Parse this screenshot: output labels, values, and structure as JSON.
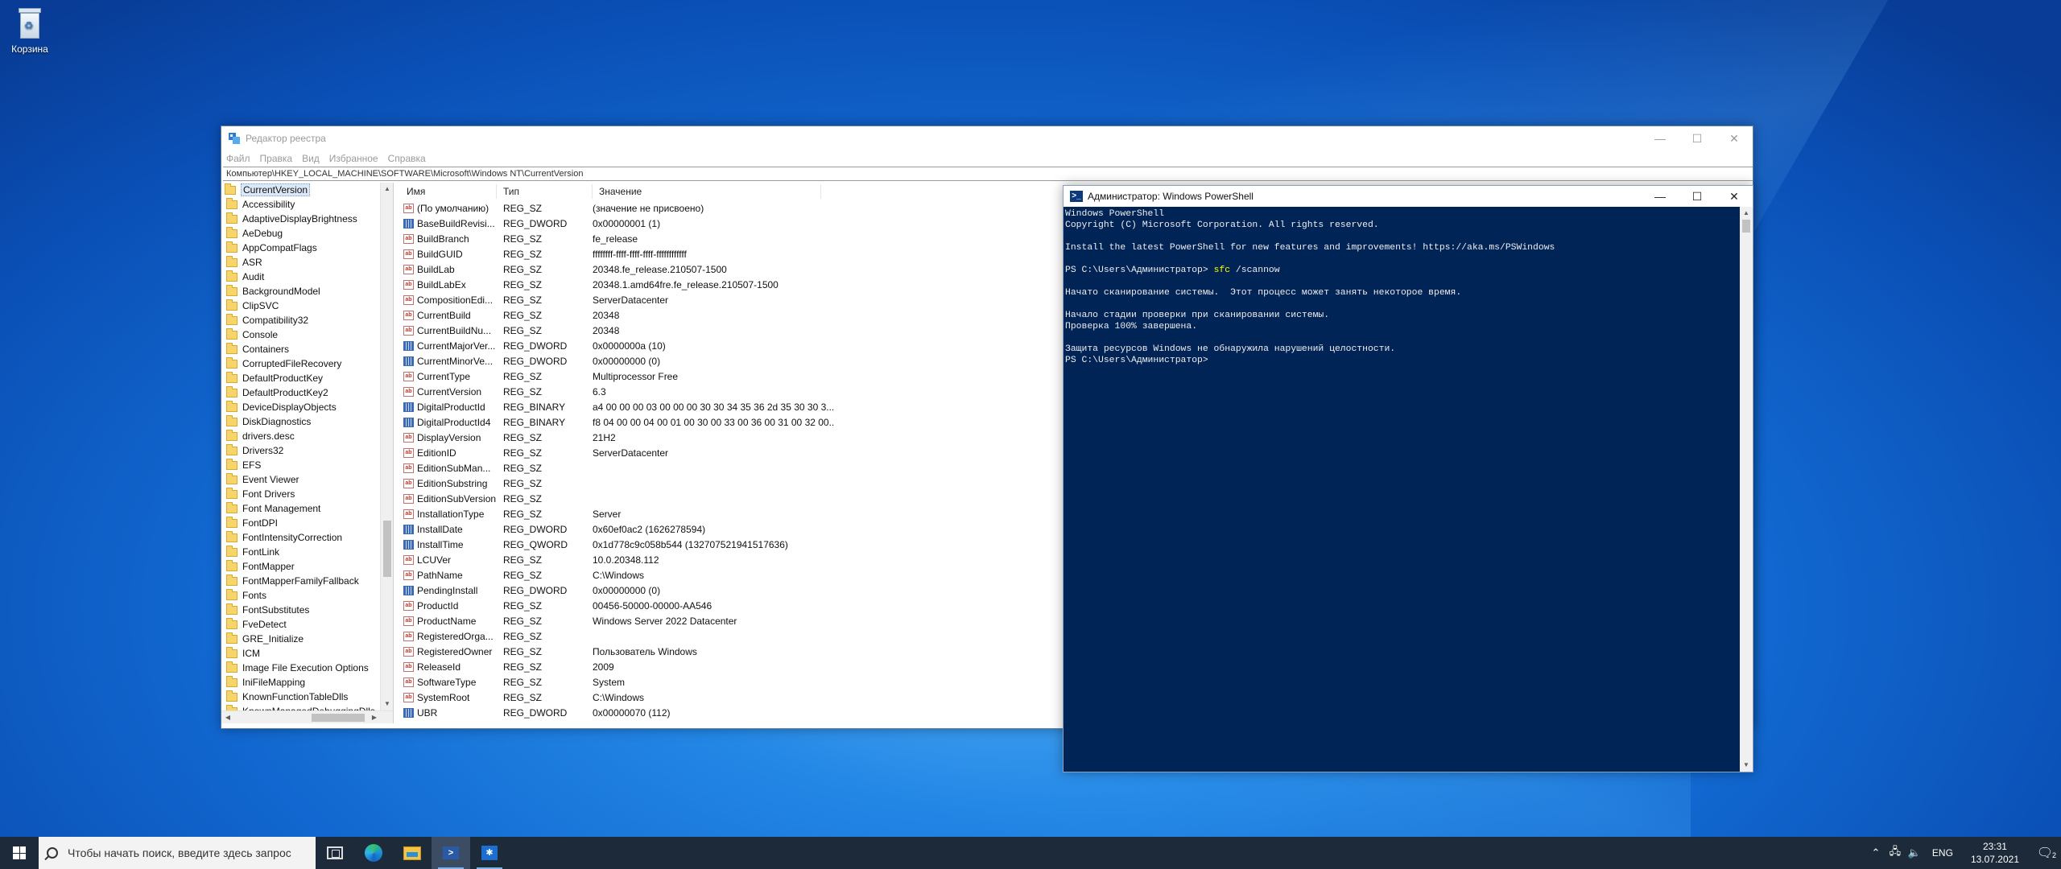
{
  "desktop": {
    "recycle_bin_label": "Корзина"
  },
  "regedit": {
    "title": "Редактор реестра",
    "menu": [
      "Файл",
      "Правка",
      "Вид",
      "Избранное",
      "Справка"
    ],
    "address": "Компьютер\\HKEY_LOCAL_MACHINE\\SOFTWARE\\Microsoft\\Windows NT\\CurrentVersion",
    "tree_selected": "CurrentVersion",
    "tree_children": [
      "Accessibility",
      "AdaptiveDisplayBrightness",
      "AeDebug",
      "AppCompatFlags",
      "ASR",
      "Audit",
      "BackgroundModel",
      "ClipSVC",
      "Compatibility32",
      "Console",
      "Containers",
      "CorruptedFileRecovery",
      "DefaultProductKey",
      "DefaultProductKey2",
      "DeviceDisplayObjects",
      "DiskDiagnostics",
      "drivers.desc",
      "Drivers32",
      "EFS",
      "Event Viewer",
      "Font Drivers",
      "Font Management",
      "FontDPI",
      "FontIntensityCorrection",
      "FontLink",
      "FontMapper",
      "FontMapperFamilyFallback",
      "Fonts",
      "FontSubstitutes",
      "FveDetect",
      "GRE_Initialize",
      "ICM",
      "Image File Execution Options",
      "IniFileMapping",
      "KnownFunctionTableDlls",
      "KnownManagedDebuggingDlls"
    ],
    "columns": {
      "name": "Имя",
      "type": "Тип",
      "value": "Значение"
    },
    "rows": [
      {
        "name": "(По умолчанию)",
        "type": "REG_SZ",
        "value": "(значение не присвоено)",
        "icon": "sz"
      },
      {
        "name": "BaseBuildRevisi...",
        "type": "REG_DWORD",
        "value": "0x00000001 (1)",
        "icon": "bin"
      },
      {
        "name": "BuildBranch",
        "type": "REG_SZ",
        "value": "fe_release",
        "icon": "sz"
      },
      {
        "name": "BuildGUID",
        "type": "REG_SZ",
        "value": "ffffffff-ffff-ffff-ffff-ffffffffffff",
        "icon": "sz"
      },
      {
        "name": "BuildLab",
        "type": "REG_SZ",
        "value": "20348.fe_release.210507-1500",
        "icon": "sz"
      },
      {
        "name": "BuildLabEx",
        "type": "REG_SZ",
        "value": "20348.1.amd64fre.fe_release.210507-1500",
        "icon": "sz"
      },
      {
        "name": "CompositionEdi...",
        "type": "REG_SZ",
        "value": "ServerDatacenter",
        "icon": "sz"
      },
      {
        "name": "CurrentBuild",
        "type": "REG_SZ",
        "value": "20348",
        "icon": "sz"
      },
      {
        "name": "CurrentBuildNu...",
        "type": "REG_SZ",
        "value": "20348",
        "icon": "sz"
      },
      {
        "name": "CurrentMajorVer...",
        "type": "REG_DWORD",
        "value": "0x0000000a (10)",
        "icon": "bin"
      },
      {
        "name": "CurrentMinorVe...",
        "type": "REG_DWORD",
        "value": "0x00000000 (0)",
        "icon": "bin"
      },
      {
        "name": "CurrentType",
        "type": "REG_SZ",
        "value": "Multiprocessor Free",
        "icon": "sz"
      },
      {
        "name": "CurrentVersion",
        "type": "REG_SZ",
        "value": "6.3",
        "icon": "sz"
      },
      {
        "name": "DigitalProductId",
        "type": "REG_BINARY",
        "value": "a4 00 00 00 03 00 00 00 30 30 34 35 36 2d 35 30 30 3...",
        "icon": "bin"
      },
      {
        "name": "DigitalProductId4",
        "type": "REG_BINARY",
        "value": "f8 04 00 00 04 00 01 00 30 00 33 00 36 00 31 00 32 00...",
        "icon": "bin"
      },
      {
        "name": "DisplayVersion",
        "type": "REG_SZ",
        "value": "21H2",
        "icon": "sz"
      },
      {
        "name": "EditionID",
        "type": "REG_SZ",
        "value": "ServerDatacenter",
        "icon": "sz"
      },
      {
        "name": "EditionSubMan...",
        "type": "REG_SZ",
        "value": "",
        "icon": "sz"
      },
      {
        "name": "EditionSubstring",
        "type": "REG_SZ",
        "value": "",
        "icon": "sz"
      },
      {
        "name": "EditionSubVersion",
        "type": "REG_SZ",
        "value": "",
        "icon": "sz"
      },
      {
        "name": "InstallationType",
        "type": "REG_SZ",
        "value": "Server",
        "icon": "sz"
      },
      {
        "name": "InstallDate",
        "type": "REG_DWORD",
        "value": "0x60ef0ac2 (1626278594)",
        "icon": "bin"
      },
      {
        "name": "InstallTime",
        "type": "REG_QWORD",
        "value": "0x1d778c9c058b544 (132707521941517636)",
        "icon": "bin"
      },
      {
        "name": "LCUVer",
        "type": "REG_SZ",
        "value": "10.0.20348.112",
        "icon": "sz"
      },
      {
        "name": "PathName",
        "type": "REG_SZ",
        "value": "C:\\Windows",
        "icon": "sz"
      },
      {
        "name": "PendingInstall",
        "type": "REG_DWORD",
        "value": "0x00000000 (0)",
        "icon": "bin"
      },
      {
        "name": "ProductId",
        "type": "REG_SZ",
        "value": "00456-50000-00000-AA546",
        "icon": "sz"
      },
      {
        "name": "ProductName",
        "type": "REG_SZ",
        "value": "Windows Server 2022 Datacenter",
        "icon": "sz"
      },
      {
        "name": "RegisteredOrga...",
        "type": "REG_SZ",
        "value": "",
        "icon": "sz"
      },
      {
        "name": "RegisteredOwner",
        "type": "REG_SZ",
        "value": "Пользователь Windows",
        "icon": "sz"
      },
      {
        "name": "ReleaseId",
        "type": "REG_SZ",
        "value": "2009",
        "icon": "sz"
      },
      {
        "name": "SoftwareType",
        "type": "REG_SZ",
        "value": "System",
        "icon": "sz"
      },
      {
        "name": "SystemRoot",
        "type": "REG_SZ",
        "value": "C:\\Windows",
        "icon": "sz"
      },
      {
        "name": "UBR",
        "type": "REG_DWORD",
        "value": "0x00000070 (112)",
        "icon": "bin"
      }
    ]
  },
  "powershell": {
    "title": "Администратор: Windows PowerShell",
    "lines": [
      "Windows PowerShell",
      "Copyright (C) Microsoft Corporation. All rights reserved.",
      "",
      "Install the latest PowerShell for new features and improvements! https://aka.ms/PSWindows",
      "",
      "",
      "",
      "Начато сканирование системы.  Этот процесс может занять некоторое время.",
      "",
      "Начало стадии проверки при сканировании системы.",
      "Проверка 100% завершена.",
      "",
      "Защита ресурсов Windows не обнаружила нарушений целостности.",
      "PS C:\\Users\\Администратор>"
    ],
    "prompt": "PS C:\\Users\\Администратор> ",
    "command": "sfc",
    "command_arg": " /scannow"
  },
  "taskbar": {
    "search_placeholder": "Чтобы начать поиск, введите здесь запрос",
    "language": "ENG",
    "time": "23:31",
    "date": "13.07.2021",
    "notification_count": "2"
  }
}
